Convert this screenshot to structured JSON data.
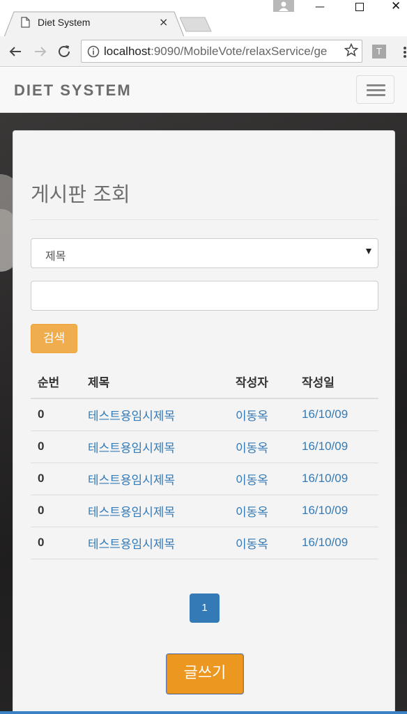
{
  "browser": {
    "tab_title": "Diet System",
    "tab_close": "×",
    "url_host": "localhost",
    "url_rest": ":9090/MobileVote/relaxService/ge",
    "extension_label": "T",
    "minimize_glyph": "—",
    "close_glyph": "✕"
  },
  "navbar": {
    "brand": "DIET SYSTEM"
  },
  "board": {
    "heading": "게시판 조회",
    "search_field_selected": "제목",
    "search_button": "검색",
    "columns": [
      "순번",
      "제목",
      "작성자",
      "작성일"
    ],
    "rows": [
      {
        "num": "0",
        "title": "테스트용임시제목",
        "author": "이동옥",
        "date": "16/10/09"
      },
      {
        "num": "0",
        "title": "테스트용임시제목",
        "author": "이동옥",
        "date": "16/10/09"
      },
      {
        "num": "0",
        "title": "테스트용임시제목",
        "author": "이동옥",
        "date": "16/10/09"
      },
      {
        "num": "0",
        "title": "테스트용임시제목",
        "author": "이동옥",
        "date": "16/10/09"
      },
      {
        "num": "0",
        "title": "테스트용임시제목",
        "author": "이동옥",
        "date": "16/10/09"
      }
    ],
    "current_page": "1",
    "write_button": "글쓰기"
  },
  "colors": {
    "link": "#337ab7",
    "warning": "#f0ad4e",
    "write_button": "#ec971f",
    "primary": "#337ab7"
  },
  "icons": [
    "page-icon",
    "back-arrow-icon",
    "forward-arrow-icon",
    "reload-icon",
    "info-icon",
    "star-icon",
    "menu-dots-icon",
    "hamburger-icon",
    "dropdown-caret-icon"
  ]
}
